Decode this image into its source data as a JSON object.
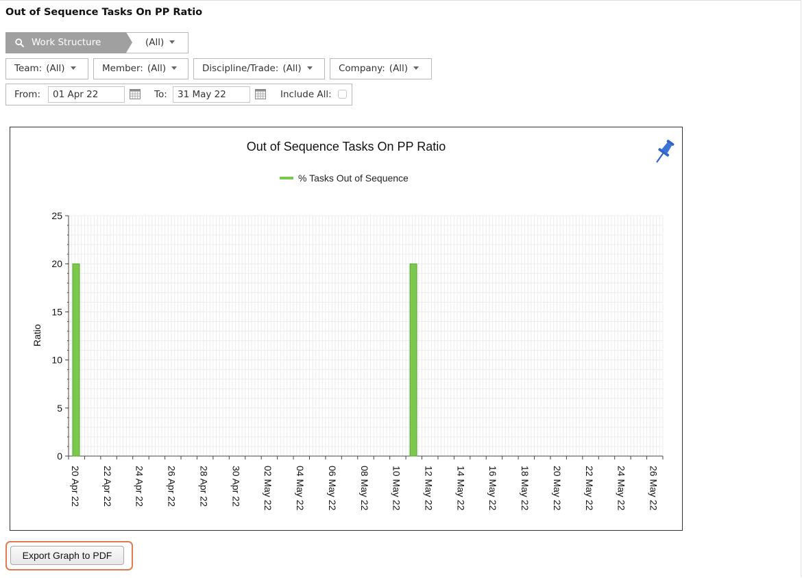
{
  "page": {
    "title": "Out of Sequence Tasks On PP Ratio"
  },
  "filters": {
    "work_structure": {
      "label": "Work Structure",
      "value": "(All)"
    },
    "team": {
      "label": "Team:",
      "value": "(All)"
    },
    "member": {
      "label": "Member:",
      "value": "(All)"
    },
    "discipline": {
      "label": "Discipline/Trade:",
      "value": "(All)"
    },
    "company": {
      "label": "Company:",
      "value": "(All)"
    },
    "from": {
      "label": "From:",
      "value": "01 Apr 22"
    },
    "to": {
      "label": "To:",
      "value": "31 May 22"
    },
    "include_all": {
      "label": "Include All:",
      "checked": false
    }
  },
  "chart_data": {
    "type": "bar",
    "title": "Out of Sequence Tasks On PP Ratio",
    "ylabel": "Ratio",
    "xlabel": "",
    "ylim": [
      0,
      25
    ],
    "yticks": [
      0,
      5,
      10,
      15,
      20,
      25
    ],
    "xlim": [
      "2022-04-20",
      "2022-05-27"
    ],
    "xtick_labels": [
      "20 Apr 22",
      "22 Apr 22",
      "24 Apr 22",
      "26 Apr 22",
      "28 Apr 22",
      "30 Apr 22",
      "02 May 22",
      "04 May 22",
      "06 May 22",
      "08 May 22",
      "10 May 22",
      "12 May 22",
      "14 May 22",
      "16 May 22",
      "18 May 22",
      "20 May 22",
      "22 May 22",
      "24 May 22",
      "26 May 22"
    ],
    "grid": true,
    "legend_position": "top-center",
    "series": [
      {
        "name": "% Tasks Out of Sequence",
        "color": "#7cc84e",
        "points": [
          {
            "x": "2022-04-20",
            "y": 20
          },
          {
            "x": "2022-05-11",
            "y": 20
          }
        ]
      }
    ]
  },
  "actions": {
    "export_label": "Export Graph to PDF"
  },
  "icons": {
    "search": "search-icon",
    "calendar": "calendar-icon",
    "pin": "pushpin-icon",
    "caret": "caret-down-icon"
  }
}
